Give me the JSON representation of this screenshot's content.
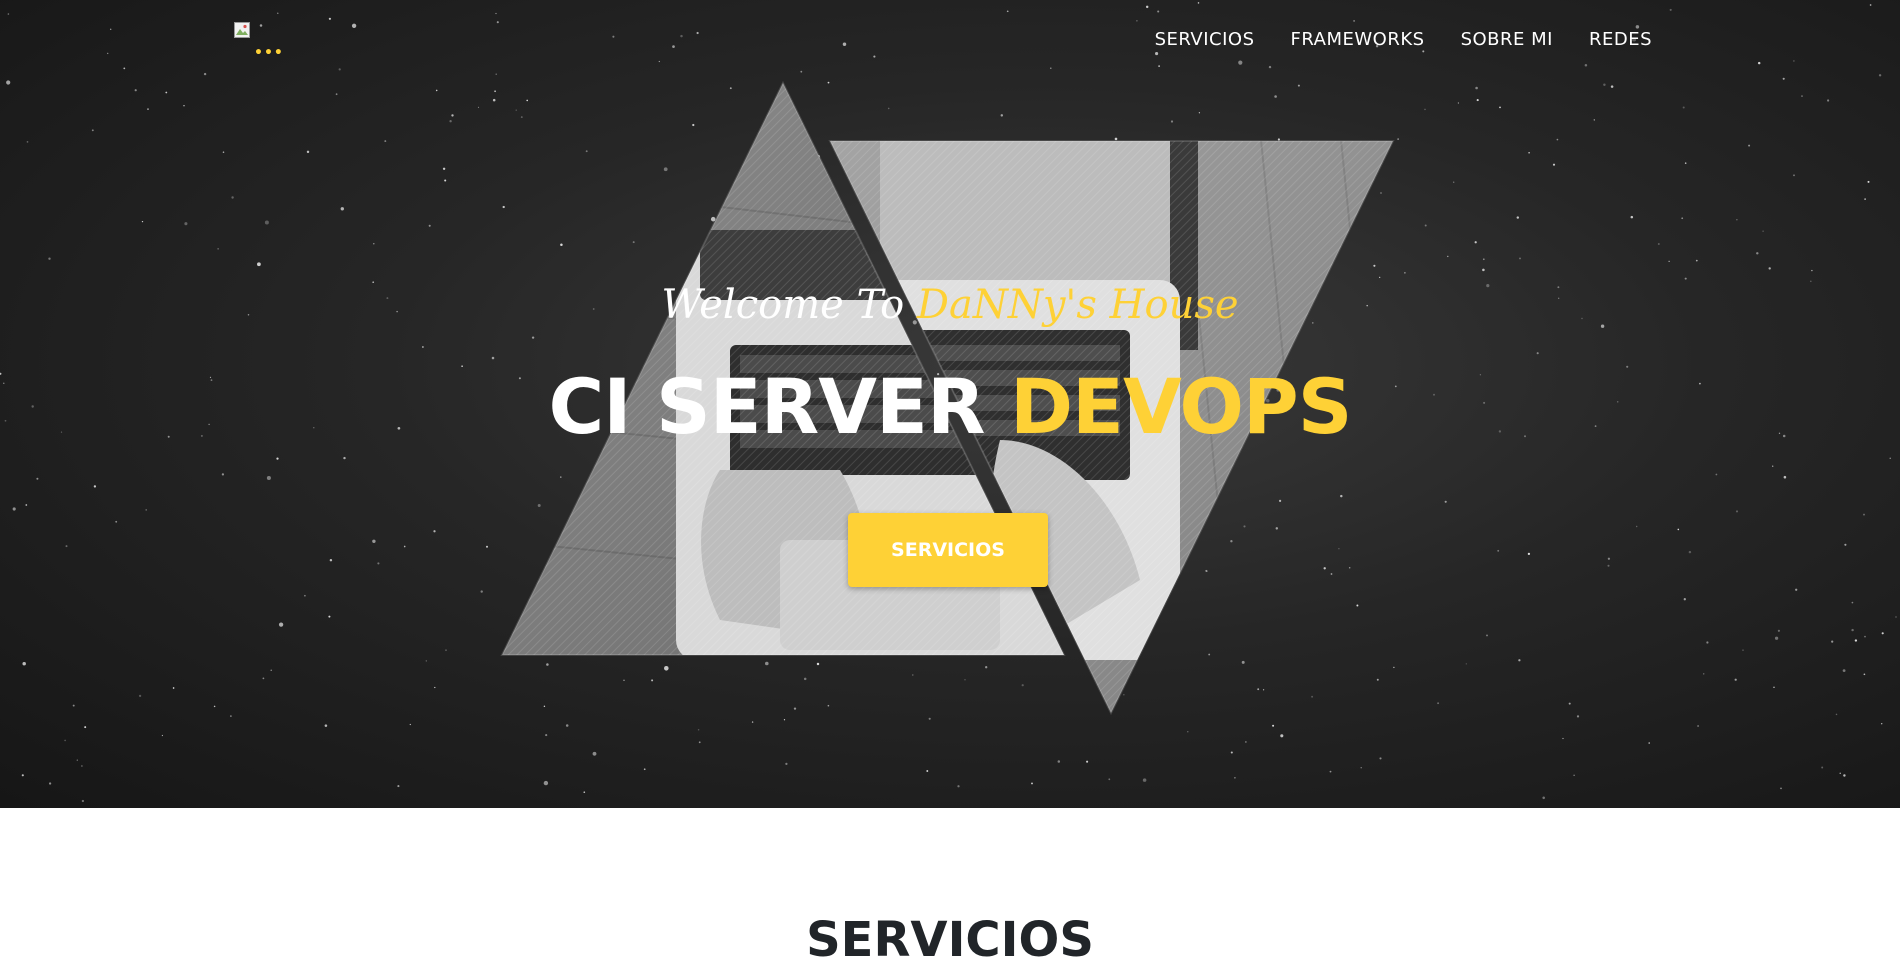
{
  "nav": {
    "logo_icon": "broken-image-icon",
    "logo_dots": "•••",
    "items": [
      {
        "label": "SERVICIOS"
      },
      {
        "label": "FRAMEWORKS"
      },
      {
        "label": "SOBRE MI"
      },
      {
        "label": "REDES"
      }
    ]
  },
  "hero": {
    "subheading_prefix": "Welcome To ",
    "subheading_accent": "DaNNy's House",
    "heading_prefix": "CI SERVER ",
    "heading_accent": "DEVOPS",
    "cta_label": "SERVICIOS",
    "image_description_icon": "laptop-typing-triangles"
  },
  "services_section": {
    "title": "SERVICIOS"
  },
  "colors": {
    "accent": "#fed136",
    "hero_background": "#262626",
    "text_light": "#ffffff",
    "text_dark": "#212529"
  }
}
